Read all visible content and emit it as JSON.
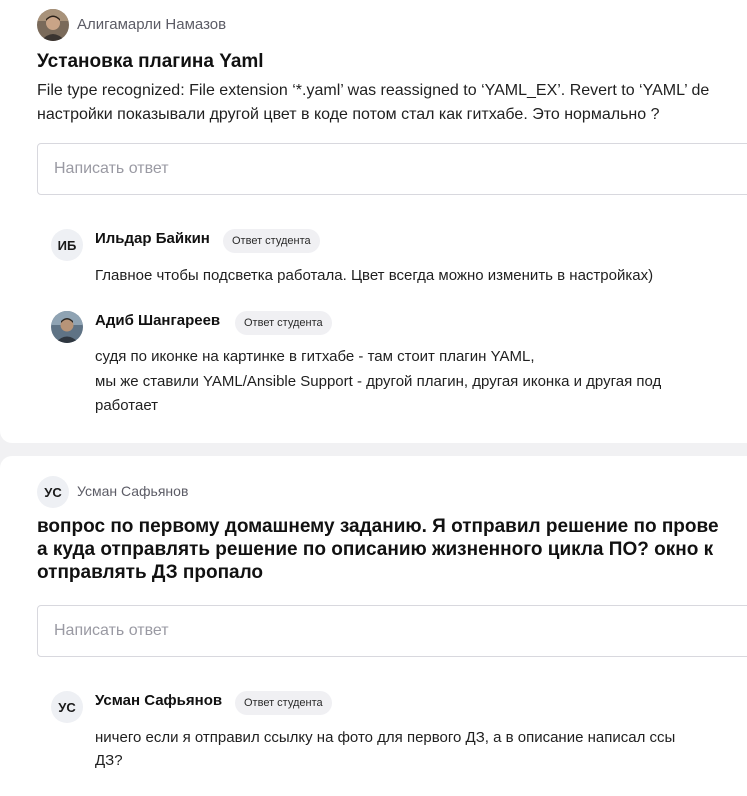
{
  "threads": [
    {
      "author": "Алигамарли Намазов",
      "title": "Установка плагина Yaml",
      "body_lines": [
        "File type recognized: File extension ‘*.yaml’ was reassigned to ‘YAML_EX’. Revert to ‘YAML’ de",
        "настройки показывали другой цвет в коде потом стал как гитхабе. Это нормально ?"
      ],
      "reply_placeholder": "Написать ответ",
      "replies": [
        {
          "initials": "ИБ",
          "author": "Ильдар Байкин",
          "badge": "Ответ студента",
          "lines": [
            "Главное чтобы подсветка работала. Цвет всегда можно изменить в настройках)"
          ]
        },
        {
          "initials": "",
          "author": "Адиб Шангареев",
          "badge": "Ответ студента",
          "lines": [
            "судя по иконке на картинке в гитхабе - там стоит плагин YAML,",
            "мы же ставили YAML/Ansible Support -  другой плагин, другая иконка и другая под",
            "работает"
          ]
        }
      ]
    },
    {
      "initials": "УС",
      "author": "Усман Сафьянов",
      "title_lines": [
        "вопрос по первому домашнему заданию. Я отправил решение по прове",
        "а куда отправлять решение по описанию жизненного цикла ПО? окно к",
        "отправлять ДЗ пропало"
      ],
      "reply_placeholder": "Написать ответ",
      "replies": [
        {
          "initials": "УС",
          "author": "Усман Сафьянов",
          "badge": "Ответ студента",
          "lines": [
            "ничего если я отправил ссылку на фото для первого ДЗ, а в описание написал ссы",
            "ДЗ?"
          ]
        }
      ]
    }
  ]
}
